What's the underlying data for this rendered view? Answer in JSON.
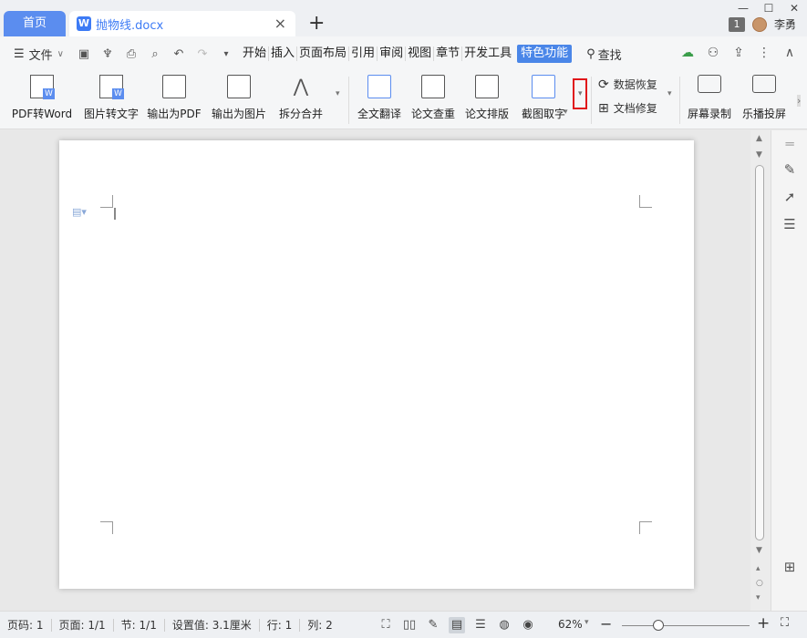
{
  "titlebar": {
    "home_tab": "首页",
    "doc_tab": "抛物线.docx",
    "doc_icon": "W",
    "close": "×",
    "add": "+",
    "badge": "1",
    "user_name": "李勇",
    "minimize": "—",
    "maximize": "☐",
    "close_window": "✕"
  },
  "menubar": {
    "file_label": "文件",
    "tabs": [
      "开始",
      "插入",
      "页面布局",
      "引用",
      "审阅",
      "视图",
      "章节",
      "开发工具"
    ],
    "active_tab": "特色功能",
    "search_label": "查找"
  },
  "ribbon": {
    "pdf_to_word": "PDF转Word",
    "image_to_text": "图片转文字",
    "export_pdf": "输出为PDF",
    "export_image": "输出为图片",
    "split_merge": "拆分合并",
    "translate": "全文翻译",
    "plagiarism": "论文查重",
    "layout": "论文排版",
    "ocr": "截图取字",
    "data_recovery": "数据恢复",
    "doc_repair": "文档修复",
    "screen_record": "屏幕录制",
    "cast": "乐播投屏"
  },
  "statusbar": {
    "page_num": "页码: 1",
    "pages": "页面: 1/1",
    "section": "节: 1/1",
    "setting": "设置值: 3.1厘米",
    "row": "行: 1",
    "col": "列: 2",
    "zoom": "62%"
  },
  "colors": {
    "accent": "#5b8def",
    "highlight_box": "#e0161a"
  }
}
